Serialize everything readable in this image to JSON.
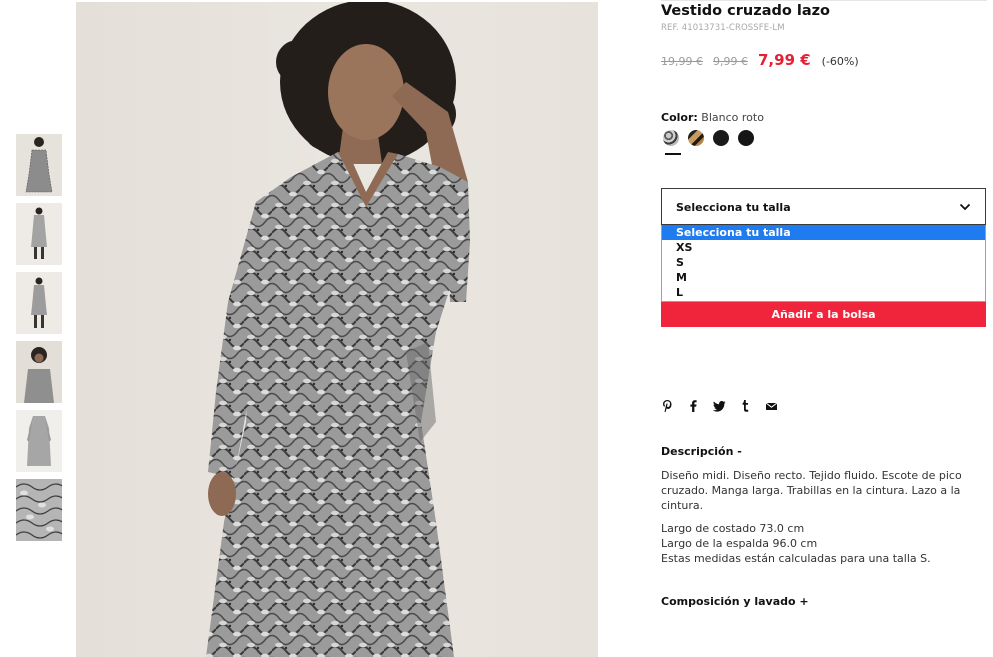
{
  "product": {
    "title": "Vestido cruzado lazo",
    "ref": "REF. 41013731-CROSSFE-LM",
    "price_original": "19,99 €",
    "price_previous": "9,99 €",
    "price_current": "7,99 €",
    "discount": "(-60%)"
  },
  "color": {
    "label": "Color:",
    "value": "Blanco roto",
    "swatches": [
      "snake-grey",
      "snake-brown",
      "black",
      "black-2"
    ],
    "selected_index": 0
  },
  "size": {
    "placeholder": "Selecciona tu talla",
    "options": [
      "Selecciona tu talla",
      "XS",
      "S",
      "M",
      "L"
    ],
    "selected_index": 0
  },
  "actions": {
    "add_to_bag": "Añadir a la bolsa"
  },
  "share": {
    "icons": [
      "pinterest-icon",
      "facebook-icon",
      "twitter-icon",
      "tumblr-icon",
      "email-icon"
    ]
  },
  "description": {
    "heading": "Descripción -",
    "text": "Diseño midi. Diseño recto. Tejido fluido. Escote de pico cruzado. Manga larga. Trabillas en la cintura. Lazo a la cintura.",
    "measures": [
      "Largo de costado 73.0 cm",
      "Largo de la espalda 96.0 cm",
      "Estas medidas están calculadas para una talla S."
    ]
  },
  "composition": {
    "heading": "Composición y lavado +"
  },
  "gallery": {
    "thumbnail_count": 6
  },
  "colors": {
    "sale_red": "#e42133",
    "button_red": "#f0243a",
    "dropdown_highlight": "#1e7bf0"
  }
}
